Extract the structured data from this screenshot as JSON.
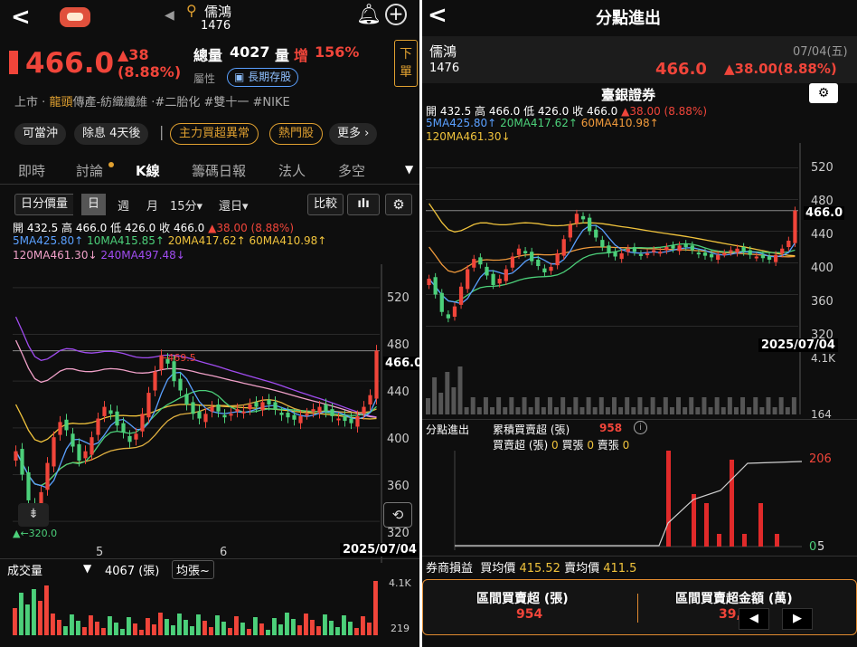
{
  "left": {
    "header": {
      "stock_name": "儒鴻",
      "stock_code": "1476"
    },
    "quote": {
      "price": "466.0",
      "change": "▲38",
      "change_pct": "(8.88%)",
      "volume_label": "總量",
      "volume": "4027",
      "vol_label": "量",
      "vol_increase": "增",
      "vol_pct": "156%",
      "attr_label": "屬性",
      "attr_tag": "長期存股",
      "sell_btn_1": "下",
      "sell_btn_2": "單"
    },
    "tags": {
      "market": "上市",
      "sep": "·",
      "leader": "龍頭",
      "sector": "傳產-紡織纖維",
      "h1": "·#二胎化",
      "h2": "#雙十一",
      "h3": "#NIKE"
    },
    "pills": [
      "可當沖",
      "除息 4天後",
      "主力買超異常",
      "熱門股",
      "更多 ›"
    ],
    "tabs": [
      "即時",
      "討論",
      "K線",
      "籌碼日報",
      "法人",
      "多空"
    ],
    "controls": {
      "period_1": "日分價量",
      "period_2": "日",
      "period_3": "週",
      "period_4": "月",
      "period_5": "15分▾",
      "period_6": "還日▾",
      "compare": "比較"
    },
    "ohlc": {
      "open_l": "開",
      "open": "432.5",
      "high_l": "高",
      "high": "466.0",
      "low_l": "低",
      "low": "426.0",
      "close_l": "收",
      "close": "466.0",
      "chg": "▲38.00 (8.88%)"
    },
    "ma_line1": {
      "ma5": "5MA425.80↑",
      "ma10": "10MA415.85↑",
      "ma20": "20MA417.62↑",
      "ma60": "60MA410.98↑"
    },
    "ma_line2": {
      "ma120": "120MA461.30↓",
      "ma240": "240MA497.48↓"
    },
    "price_axis": [
      "520",
      "480",
      "440",
      "400",
      "360",
      "320"
    ],
    "price_tag": "466.0",
    "high_note": "←469.5",
    "low_note": "▲←320.0",
    "months": [
      "5",
      "6"
    ],
    "date_tag": "2025/07/04",
    "vol_row": {
      "selector": "成交量",
      "arrow": "▼",
      "value": "4067 (張)",
      "avg": "均張~"
    },
    "vol_axis": [
      "4.1K",
      "219"
    ]
  },
  "right": {
    "header": {
      "title": "分點進出"
    },
    "stock": {
      "name": "儒鴻",
      "code": "1476",
      "date": "07/04(五)",
      "price": "466.0",
      "change": "▲38.00(8.88%)"
    },
    "broker": "臺銀證券",
    "ohlc": {
      "open_l": "開",
      "open": "432.5",
      "high_l": "高",
      "high": "466.0",
      "low_l": "低",
      "low": "426.0",
      "close_l": "收",
      "close": "466.0",
      "chg": "▲38.00 (8.88%)"
    },
    "ma_line1": {
      "ma5": "5MA425.80↑",
      "ma20": "20MA417.62↑",
      "ma60": "60MA410.98↑"
    },
    "ma_line2": {
      "ma120": "120MA461.30↓"
    },
    "price_axis": [
      "520",
      "480",
      "440",
      "400",
      "360",
      "320"
    ],
    "price_tag": "466.0",
    "date_tag": "2025/07/04",
    "vol_axis": [
      "4.1K",
      "164"
    ],
    "branch": {
      "label": "分點進出",
      "cum_label": "累積買賣超 (張)",
      "cum": "958",
      "net_label": "買賣超 (張)",
      "net": "0",
      "buy_label": "買張",
      "buy": "0",
      "sell_label": "賣張",
      "sell": "0"
    },
    "branch_axis": [
      "206",
      "0",
      "5"
    ],
    "pnl": {
      "label": "券商損益",
      "buy_avg_label": "買均價",
      "buy_avg": "415.52",
      "sell_avg_label": "賣均價",
      "sell_avg": "411.5"
    },
    "summary": {
      "net_label": "區間買賣超 (張)",
      "net": "954",
      "amount_label": "區間買賣超金額 (萬)",
      "amount": "39,650"
    }
  }
}
